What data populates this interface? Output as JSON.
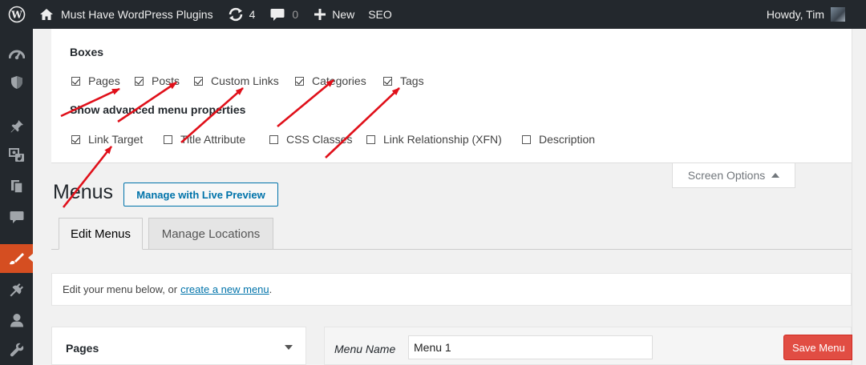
{
  "adminbar": {
    "site_name": "Must Have WordPress Plugins",
    "updates_count": "4",
    "comments_count": "0",
    "new_label": "New",
    "seo_label": "SEO",
    "greeting": "Howdy, Tim"
  },
  "screen_options": {
    "boxes_heading": "Boxes",
    "boxes": [
      {
        "label": "Pages",
        "checked": true
      },
      {
        "label": "Posts",
        "checked": true
      },
      {
        "label": "Custom Links",
        "checked": true
      },
      {
        "label": "Categories",
        "checked": true
      },
      {
        "label": "Tags",
        "checked": true
      }
    ],
    "advanced_heading": "Show advanced menu properties",
    "advanced": [
      {
        "label": "Link Target",
        "checked": true
      },
      {
        "label": "Title Attribute",
        "checked": false
      },
      {
        "label": "CSS Classes",
        "checked": false
      },
      {
        "label": "Link Relationship (XFN)",
        "checked": false
      },
      {
        "label": "Description",
        "checked": false
      }
    ],
    "tab_label": "Screen Options"
  },
  "page": {
    "title": "Menus",
    "live_preview_label": "Manage with Live Preview"
  },
  "tabs": [
    {
      "label": "Edit Menus",
      "active": true
    },
    {
      "label": "Manage Locations",
      "active": false
    }
  ],
  "notice": {
    "text": "Edit your menu below, or",
    "link": "create a new menu",
    "suffix": "."
  },
  "pages_box": {
    "title": "Pages"
  },
  "menu_edit": {
    "name_label": "Menu Name",
    "name_value": "Menu 1",
    "save_label": "Save Menu"
  },
  "colors": {
    "adminbar_bg": "#23282d",
    "accent_active": "#d54e21",
    "link": "#0073aa",
    "save_button": "#e14d43",
    "annotation_arrow": "#e0101a"
  }
}
